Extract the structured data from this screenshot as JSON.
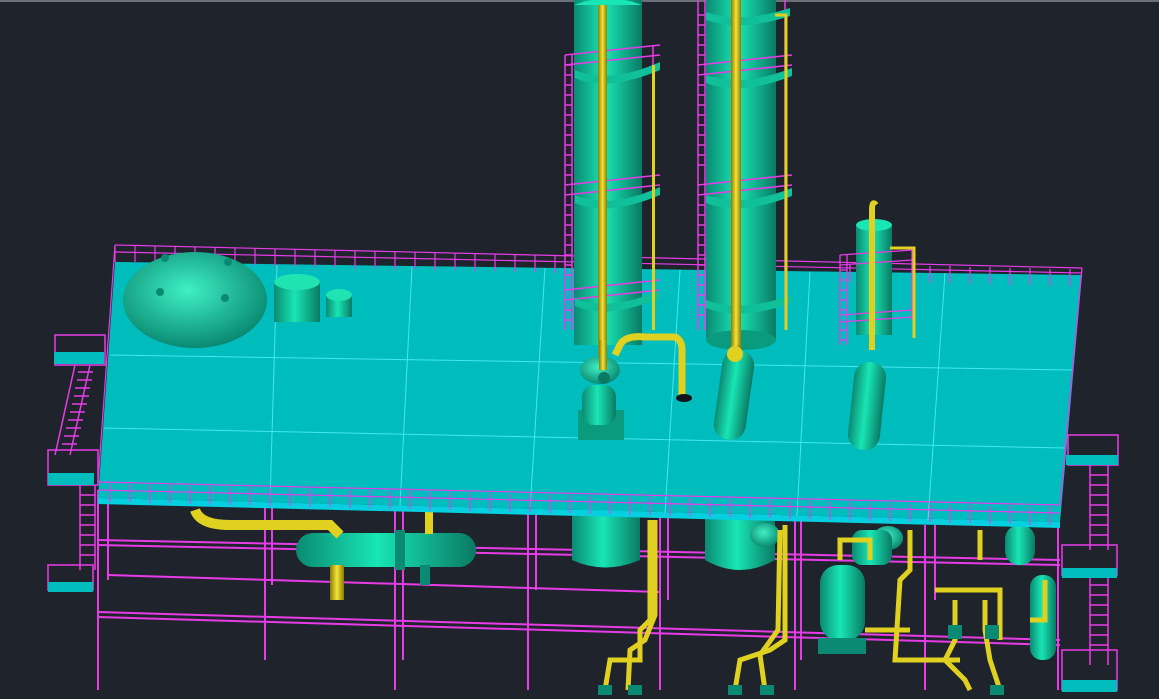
{
  "viewport": {
    "kind": "3d-cad-model",
    "background": "#1f242c"
  },
  "colors": {
    "deck": "#00bdbd",
    "deck_edge": "#00e5ff",
    "steel": "#e83be8",
    "vessel": "#10d6a6",
    "vessel_dark": "#0a8a72",
    "pipe": "#e0d020",
    "pipe_dark": "#9a8c00"
  },
  "model": {
    "towers": [
      "tower-left",
      "tower-right"
    ],
    "equipment": [
      "spherical-drum",
      "cylindrical-tank",
      "small-tank",
      "pump",
      "heat-exchanger",
      "small-column",
      "horizontal-exchanger",
      "vertical-vessel"
    ]
  }
}
